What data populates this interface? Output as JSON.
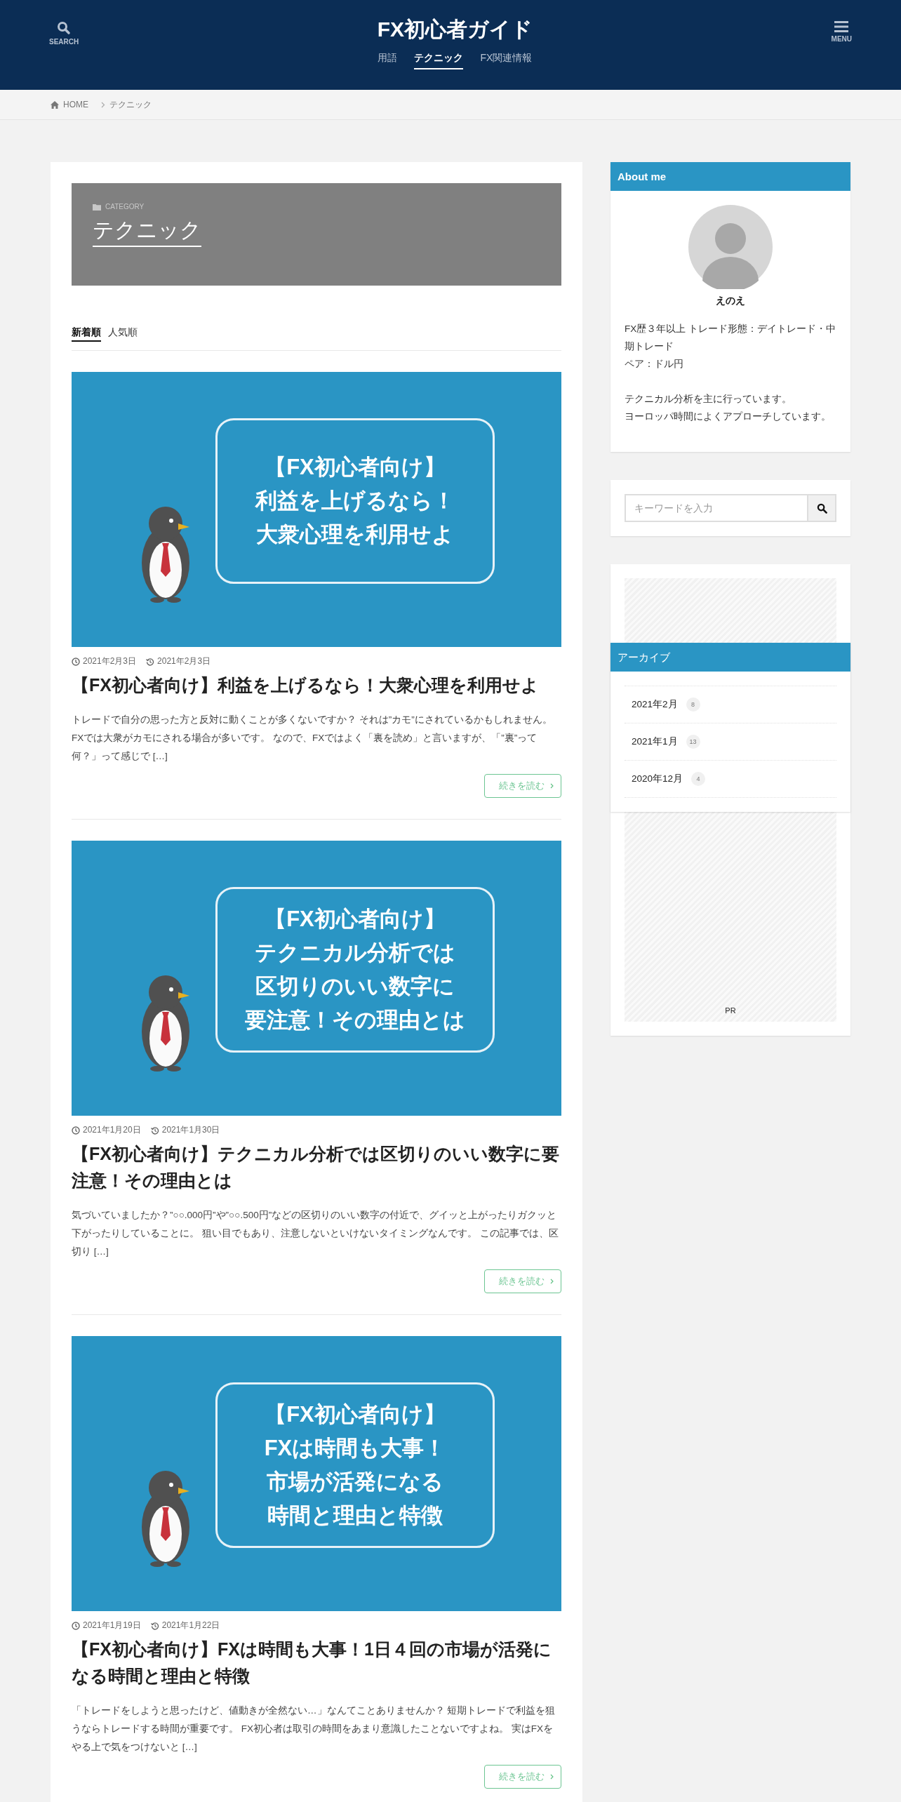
{
  "header": {
    "search_label": "SEARCH",
    "site_title": "FX初心者ガイド",
    "menu_label": "MENU",
    "nav": [
      {
        "label": "用語",
        "selected": false
      },
      {
        "label": "テクニック",
        "selected": true
      },
      {
        "label": "FX関連情報",
        "selected": false
      }
    ]
  },
  "breadcrumb": [
    "HOME",
    "テクニック"
  ],
  "category": {
    "label": "CATEGORY",
    "title": "テクニック"
  },
  "sort_tabs": [
    {
      "label": "新着順",
      "selected": true
    },
    {
      "label": "人気順",
      "selected": false
    }
  ],
  "articles": [
    {
      "thumbnail_lines": [
        "【FX初心者向け】",
        "利益を上げるなら！",
        "大衆心理を利用せよ"
      ],
      "published": "2021年2月3日",
      "updated": "2021年2月3日",
      "title": "【FX初心者向け】利益を上げるなら！大衆心理を利用せよ",
      "excerpt": " トレードで自分の思った方と反対に動くことが多くないですか？ それは”カモ”にされているかもしれません。 FXでは大衆がカモにされる場合が多いです。 なので、FXではよく「裏を読め」と言いますが、「”裏”って何？」って感じで […]",
      "read_more": "続きを読む"
    },
    {
      "thumbnail_lines": [
        "【FX初心者向け】",
        "テクニカル分析では",
        "区切りのいい数字に",
        "要注意！その理由とは"
      ],
      "published": "2021年1月20日",
      "updated": "2021年1月30日",
      "title": "【FX初心者向け】テクニカル分析では区切りのいい数字に要注意！その理由とは",
      "excerpt": " 気づいていましたか？”○○.000円”や”○○.500円”などの区切りのいい数字の付近で、グイッと上がったりガクッと下がったりしていることに。 狙い目でもあり、注意しないといけないタイミングなんです。  この記事では、区切り […]",
      "read_more": "続きを読む"
    },
    {
      "thumbnail_lines": [
        "【FX初心者向け】",
        "FXは時間も大事！",
        "市場が活発になる",
        "時間と理由と特徴"
      ],
      "published": "2021年1月19日",
      "updated": "2021年1月22日",
      "title": "【FX初心者向け】FXは時間も大事！1日４回の市場が活発になる時間と理由と特徴",
      "excerpt": "「トレードをしようと思ったけど、値動きが全然ない…」なんてことありませんか？ 短期トレードで利益を狙うならトレードする時間が重要です。 FX初心者は取引の時間をあまり意識したことないですよね。 実はFXをやる上で気をつけないと […]",
      "read_more": "続きを読む"
    }
  ],
  "sidebar": {
    "about": {
      "heading": "About me",
      "name": "えのえ",
      "bio_paragraphs": [
        [
          "FX歴３年以上 トレード形態：デイトレード・中期トレード",
          "ペア：ドル円"
        ],
        [
          "テクニカル分析を主に行っています。",
          "ヨーロッパ時間によくアプローチしています。"
        ]
      ]
    },
    "search": {
      "placeholder": "キーワードを入力"
    },
    "ad": {
      "label": "PR"
    },
    "archive": {
      "heading": "アーカイブ",
      "items": [
        {
          "label": "2021年2月",
          "count": "8"
        },
        {
          "label": "2021年1月",
          "count": "13"
        },
        {
          "label": "2020年12月",
          "count": "4"
        }
      ]
    }
  }
}
